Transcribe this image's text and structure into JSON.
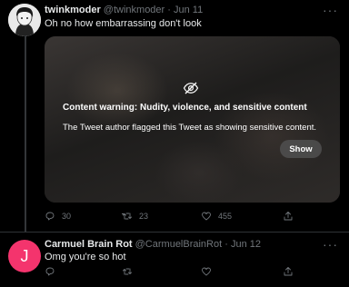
{
  "tweets": [
    {
      "name": "twinkmoder",
      "handle": "@twinkmoder",
      "separator": "·",
      "date": "Jun 11",
      "text": "Oh no how embarrassing don't look",
      "media_warning": {
        "title": "Content warning: Nudity, violence, and sensitive content",
        "body": "The Tweet author flagged this Tweet as showing sensitive content.",
        "show_label": "Show"
      },
      "actions": {
        "replies": "30",
        "retweets": "23",
        "likes": "455"
      },
      "more": "···"
    },
    {
      "avatar_letter": "J",
      "avatar_color": "#f4346d",
      "name": "Carmuel Brain Rot",
      "handle": "@CarmuelBrainRot",
      "separator": "·",
      "date": "Jun 12",
      "text": "Omg you're so hot",
      "more": "···"
    }
  ],
  "icons": {
    "reply": "reply-icon",
    "retweet": "retweet-icon",
    "like": "heart-icon",
    "share": "share-icon",
    "warning": "eye-slash-icon"
  },
  "colors": {
    "background": "#000000",
    "text": "#e7e9ea",
    "secondary": "#71767b",
    "divider": "#2f3336"
  }
}
